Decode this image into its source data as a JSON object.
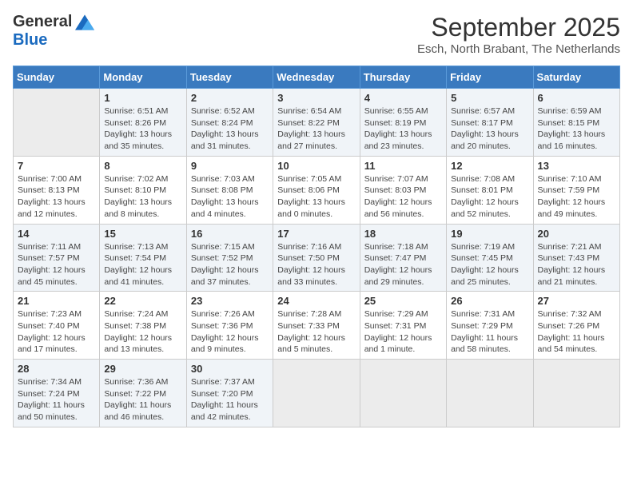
{
  "header": {
    "logo_general": "General",
    "logo_blue": "Blue",
    "month_title": "September 2025",
    "location": "Esch, North Brabant, The Netherlands"
  },
  "weekdays": [
    "Sunday",
    "Monday",
    "Tuesday",
    "Wednesday",
    "Thursday",
    "Friday",
    "Saturday"
  ],
  "weeks": [
    [
      {
        "day": "",
        "empty": true
      },
      {
        "day": "1",
        "rise": "6:51 AM",
        "set": "8:26 PM",
        "daylight": "13 hours and 35 minutes."
      },
      {
        "day": "2",
        "rise": "6:52 AM",
        "set": "8:24 PM",
        "daylight": "13 hours and 31 minutes."
      },
      {
        "day": "3",
        "rise": "6:54 AM",
        "set": "8:22 PM",
        "daylight": "13 hours and 27 minutes."
      },
      {
        "day": "4",
        "rise": "6:55 AM",
        "set": "8:19 PM",
        "daylight": "13 hours and 23 minutes."
      },
      {
        "day": "5",
        "rise": "6:57 AM",
        "set": "8:17 PM",
        "daylight": "13 hours and 20 minutes."
      },
      {
        "day": "6",
        "rise": "6:59 AM",
        "set": "8:15 PM",
        "daylight": "13 hours and 16 minutes."
      }
    ],
    [
      {
        "day": "7",
        "rise": "7:00 AM",
        "set": "8:13 PM",
        "daylight": "13 hours and 12 minutes."
      },
      {
        "day": "8",
        "rise": "7:02 AM",
        "set": "8:10 PM",
        "daylight": "13 hours and 8 minutes."
      },
      {
        "day": "9",
        "rise": "7:03 AM",
        "set": "8:08 PM",
        "daylight": "13 hours and 4 minutes."
      },
      {
        "day": "10",
        "rise": "7:05 AM",
        "set": "8:06 PM",
        "daylight": "13 hours and 0 minutes."
      },
      {
        "day": "11",
        "rise": "7:07 AM",
        "set": "8:03 PM",
        "daylight": "12 hours and 56 minutes."
      },
      {
        "day": "12",
        "rise": "7:08 AM",
        "set": "8:01 PM",
        "daylight": "12 hours and 52 minutes."
      },
      {
        "day": "13",
        "rise": "7:10 AM",
        "set": "7:59 PM",
        "daylight": "12 hours and 49 minutes."
      }
    ],
    [
      {
        "day": "14",
        "rise": "7:11 AM",
        "set": "7:57 PM",
        "daylight": "12 hours and 45 minutes."
      },
      {
        "day": "15",
        "rise": "7:13 AM",
        "set": "7:54 PM",
        "daylight": "12 hours and 41 minutes."
      },
      {
        "day": "16",
        "rise": "7:15 AM",
        "set": "7:52 PM",
        "daylight": "12 hours and 37 minutes."
      },
      {
        "day": "17",
        "rise": "7:16 AM",
        "set": "7:50 PM",
        "daylight": "12 hours and 33 minutes."
      },
      {
        "day": "18",
        "rise": "7:18 AM",
        "set": "7:47 PM",
        "daylight": "12 hours and 29 minutes."
      },
      {
        "day": "19",
        "rise": "7:19 AM",
        "set": "7:45 PM",
        "daylight": "12 hours and 25 minutes."
      },
      {
        "day": "20",
        "rise": "7:21 AM",
        "set": "7:43 PM",
        "daylight": "12 hours and 21 minutes."
      }
    ],
    [
      {
        "day": "21",
        "rise": "7:23 AM",
        "set": "7:40 PM",
        "daylight": "12 hours and 17 minutes."
      },
      {
        "day": "22",
        "rise": "7:24 AM",
        "set": "7:38 PM",
        "daylight": "12 hours and 13 minutes."
      },
      {
        "day": "23",
        "rise": "7:26 AM",
        "set": "7:36 PM",
        "daylight": "12 hours and 9 minutes."
      },
      {
        "day": "24",
        "rise": "7:28 AM",
        "set": "7:33 PM",
        "daylight": "12 hours and 5 minutes."
      },
      {
        "day": "25",
        "rise": "7:29 AM",
        "set": "7:31 PM",
        "daylight": "12 hours and 1 minute."
      },
      {
        "day": "26",
        "rise": "7:31 AM",
        "set": "7:29 PM",
        "daylight": "11 hours and 58 minutes."
      },
      {
        "day": "27",
        "rise": "7:32 AM",
        "set": "7:26 PM",
        "daylight": "11 hours and 54 minutes."
      }
    ],
    [
      {
        "day": "28",
        "rise": "7:34 AM",
        "set": "7:24 PM",
        "daylight": "11 hours and 50 minutes."
      },
      {
        "day": "29",
        "rise": "7:36 AM",
        "set": "7:22 PM",
        "daylight": "11 hours and 46 minutes."
      },
      {
        "day": "30",
        "rise": "7:37 AM",
        "set": "7:20 PM",
        "daylight": "11 hours and 42 minutes."
      },
      {
        "day": "",
        "empty": true
      },
      {
        "day": "",
        "empty": true
      },
      {
        "day": "",
        "empty": true
      },
      {
        "day": "",
        "empty": true
      }
    ]
  ]
}
